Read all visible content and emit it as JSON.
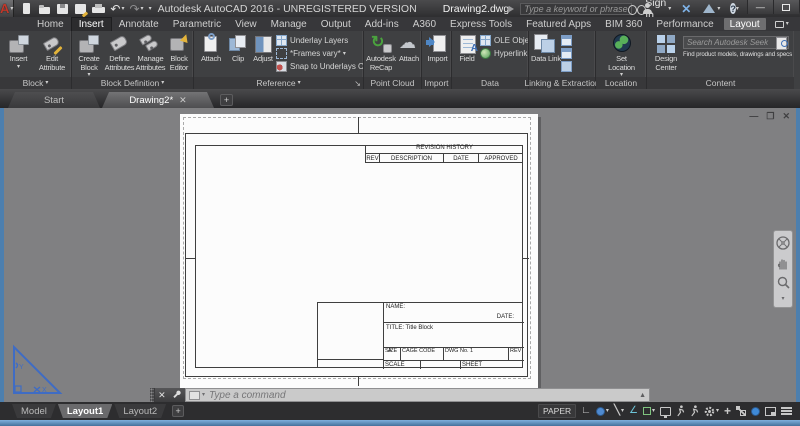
{
  "colors": {
    "accent_blue": "#5b9bd5",
    "window_border": "#4d7fae",
    "close_red": "#b13a2e",
    "canvas_gray": "#808082"
  },
  "titlebar": {
    "app_title": "Autodesk AutoCAD 2016 - UNREGISTERED VERSION",
    "doc_title": "Drawing2.dwg",
    "search_placeholder": "Type a keyword or phrase",
    "sign_in": "Sign In"
  },
  "tabs": [
    "Home",
    "Insert",
    "Annotate",
    "Parametric",
    "View",
    "Manage",
    "Output",
    "Add-ins",
    "A360",
    "Express Tools",
    "Featured Apps",
    "BIM 360",
    "Performance",
    "Layout"
  ],
  "panels": {
    "block": {
      "title": "Block",
      "insert": "Insert",
      "edit_attribute": "Edit Attribute"
    },
    "block_definition": {
      "title": "Block Definition",
      "create_block": "Create Block",
      "define_attributes": "Define Attributes",
      "manage_attributes": "Manage Attributes",
      "block_editor": "Block Editor"
    },
    "reference": {
      "title": "Reference",
      "attach": "Attach",
      "clip": "Clip",
      "adjust": "Adjust",
      "underlay_layers": "Underlay Layers",
      "frames": "*Frames vary*",
      "snap": "Snap to Underlays OFF"
    },
    "point_cloud": {
      "title": "Point Cloud",
      "recap": "Autodesk ReCap",
      "attach": "Attach"
    },
    "import": {
      "title": "Import",
      "import": "Import"
    },
    "data": {
      "title": "Data",
      "field": "Field",
      "ole_object": "OLE Object",
      "hyperlink": "Hyperlink"
    },
    "linking": {
      "title": "Linking & Extraction",
      "data_link": "Data Link"
    },
    "location": {
      "title": "Location",
      "set_location": "Set Location"
    },
    "content": {
      "title": "Content",
      "design_center": "Design Center",
      "seek_placeholder": "Search Autodesk Seek",
      "seek_caption": "Find product models, drawings and specs"
    }
  },
  "file_tabs": {
    "start": "Start",
    "drawing": "Drawing2*"
  },
  "sheet": {
    "revision_title": "REVISION HISTORY",
    "col_rev": "REV",
    "col_description": "DESCRIPTION",
    "col_date": "DATE",
    "col_approved": "APPROVED",
    "name_label": "NAME:",
    "date_label": "DATE:",
    "title_label": "TITLE: Title Block",
    "size_label": "SIZE",
    "size_value": "A",
    "cage_label": "CAGE CODE",
    "dwg_label": "DWG No. 1",
    "rev_label": "REV",
    "scale_label": "SCALE",
    "sheet_label": "SHEET",
    "ucs_x": "X",
    "ucs_y": "Y"
  },
  "command": {
    "placeholder": "Type a command"
  },
  "status": {
    "paper": "PAPER",
    "model": "Model",
    "layout1": "Layout1",
    "layout2": "Layout2"
  }
}
